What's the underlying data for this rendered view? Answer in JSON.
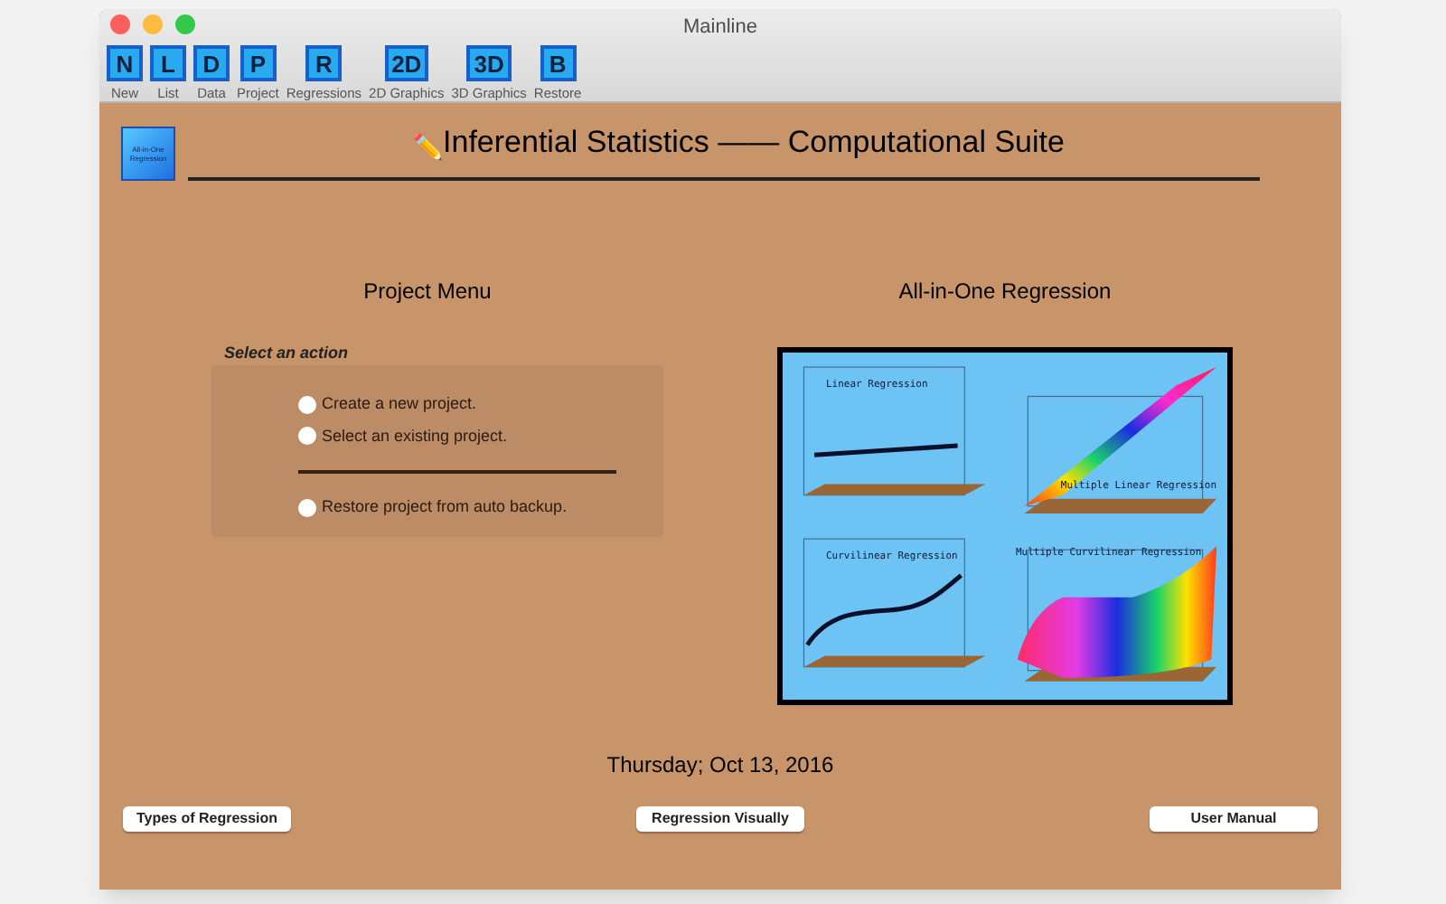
{
  "window": {
    "title": "Mainline"
  },
  "toolbar": [
    {
      "glyph": "N",
      "label": "New"
    },
    {
      "glyph": "L",
      "label": "List"
    },
    {
      "glyph": "D",
      "label": "Data"
    },
    {
      "glyph": "P",
      "label": "Project"
    },
    {
      "glyph": "R",
      "label": "Regressions"
    },
    {
      "glyph": "2D",
      "label": "2D Graphics"
    },
    {
      "glyph": "3D",
      "label": "3D Graphics"
    },
    {
      "glyph": "B",
      "label": "Restore"
    }
  ],
  "logo": {
    "text": "All-in-One Regression"
  },
  "heading": {
    "icon": "✏️",
    "title": "Inferential Statistics —— Computational Suite"
  },
  "project_menu": {
    "title": "Project Menu",
    "caption": "Select an action",
    "options": [
      {
        "label": "Create a new project.",
        "selected": false,
        "kind": "radio"
      },
      {
        "label": "Select an existing project.",
        "selected": false,
        "kind": "radio"
      },
      {
        "kind": "separator"
      },
      {
        "label": "Restore project from auto backup.",
        "selected": false,
        "kind": "radio"
      }
    ]
  },
  "preview": {
    "title": "All-in-One Regression",
    "panels": [
      {
        "label": "Linear Regression",
        "kind": "line"
      },
      {
        "label": "Multiple Linear Regression",
        "kind": "plane"
      },
      {
        "label": "Curvilinear Regression",
        "kind": "curve"
      },
      {
        "label": "Multiple Curvilinear Regression",
        "kind": "surface"
      }
    ]
  },
  "date": "Thursday; Oct 13, 2016",
  "buttons": [
    "Types of Regression",
    "Regression Visually",
    "User Manual"
  ]
}
